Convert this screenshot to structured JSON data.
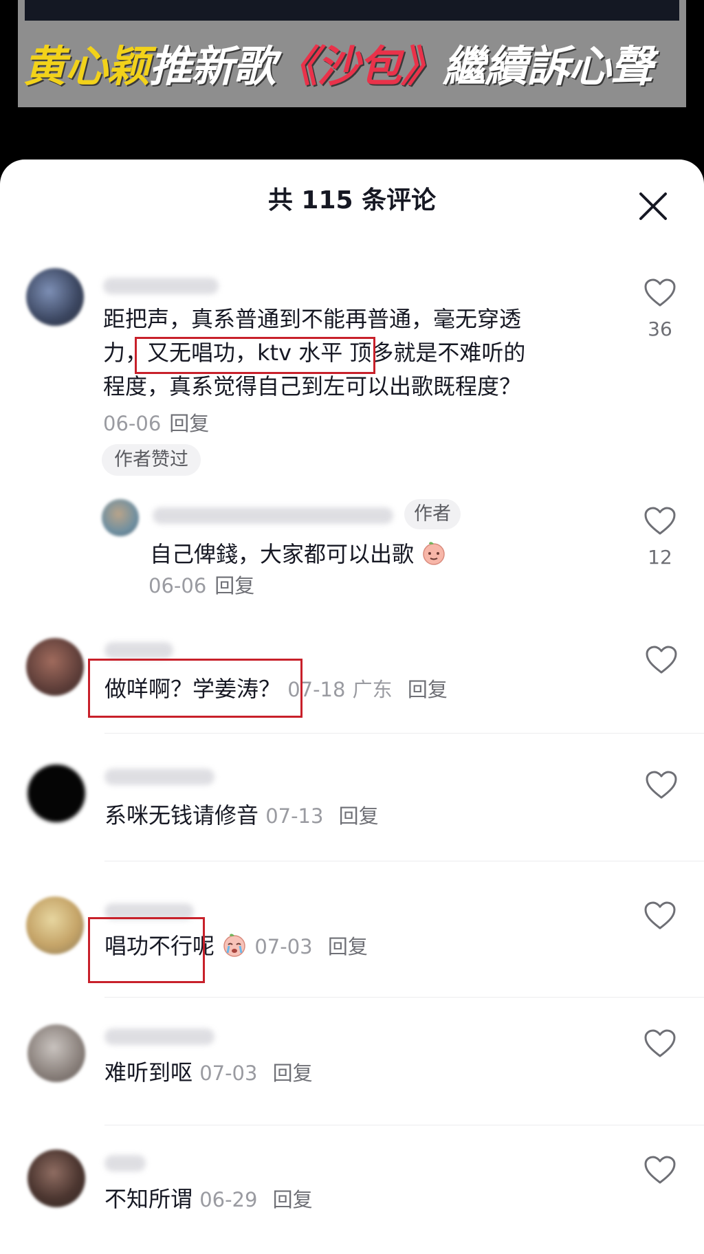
{
  "video": {
    "banner_parts": [
      {
        "text": "黄心颖",
        "color": "yellow"
      },
      {
        "text": "推新歌",
        "color": "white"
      },
      {
        "text": "《沙包》",
        "color": "red"
      },
      {
        "text": "繼續訴心聲",
        "color": "white"
      }
    ]
  },
  "sheet": {
    "title": "共 115 条评论",
    "close_icon": "close-icon"
  },
  "comments": [
    {
      "lines": [
        "距把声，真系普通到不能再普通，毫无穿透",
        "力，又无唱功，ktv 水平  顶多就是不难听的",
        "程度，真系觉得自己到左可以出歌既程度？"
      ],
      "date": "06-06",
      "reply_label": "回复",
      "author_liked_tag": "作者赞过",
      "likes": "36"
    },
    {
      "text": "自己俾錢，大家都可以出歌",
      "author_tag": "作者",
      "date": "06-06",
      "reply_label": "回复",
      "likes": "12"
    },
    {
      "text": "做咩啊？学姜涛？",
      "date": "07-18",
      "location": "广东",
      "reply_label": "回复"
    },
    {
      "text": "系咪无钱请修音",
      "date": "07-13",
      "reply_label": "回复"
    },
    {
      "text": "唱功不行呢",
      "date": "07-03",
      "reply_label": "回复"
    },
    {
      "text": "难听到呕",
      "date": "07-03",
      "reply_label": "回复"
    },
    {
      "text": "不知所谓",
      "date": "06-29",
      "reply_label": "回复"
    }
  ],
  "colors": {
    "highlight_box": "#c8202a",
    "banner_yellow": "#f2d21a",
    "banner_red": "#e9324a",
    "meta_gray": "#9a9ba1"
  }
}
